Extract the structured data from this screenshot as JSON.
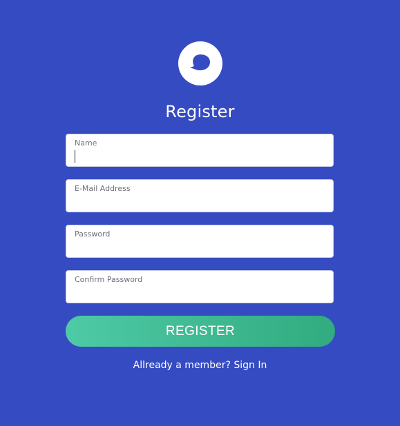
{
  "app": {
    "logo_icon": "chat-bubble-icon",
    "colors": {
      "background": "#354bc1",
      "field_background": "#ffffff",
      "button_gradient_start": "#4ecaa6",
      "button_gradient_end": "#31ab7f",
      "text_on_background": "#ffffff"
    }
  },
  "form": {
    "title": "Register",
    "fields": [
      {
        "label": "Name",
        "value": ""
      },
      {
        "label": "E-Mail Address",
        "value": ""
      },
      {
        "label": "Password",
        "value": ""
      },
      {
        "label": "Confirm Password",
        "value": ""
      }
    ],
    "submit_label": "REGISTER"
  },
  "footer": {
    "prompt_text": "Allready a member?",
    "signin_link": "Sign In"
  }
}
